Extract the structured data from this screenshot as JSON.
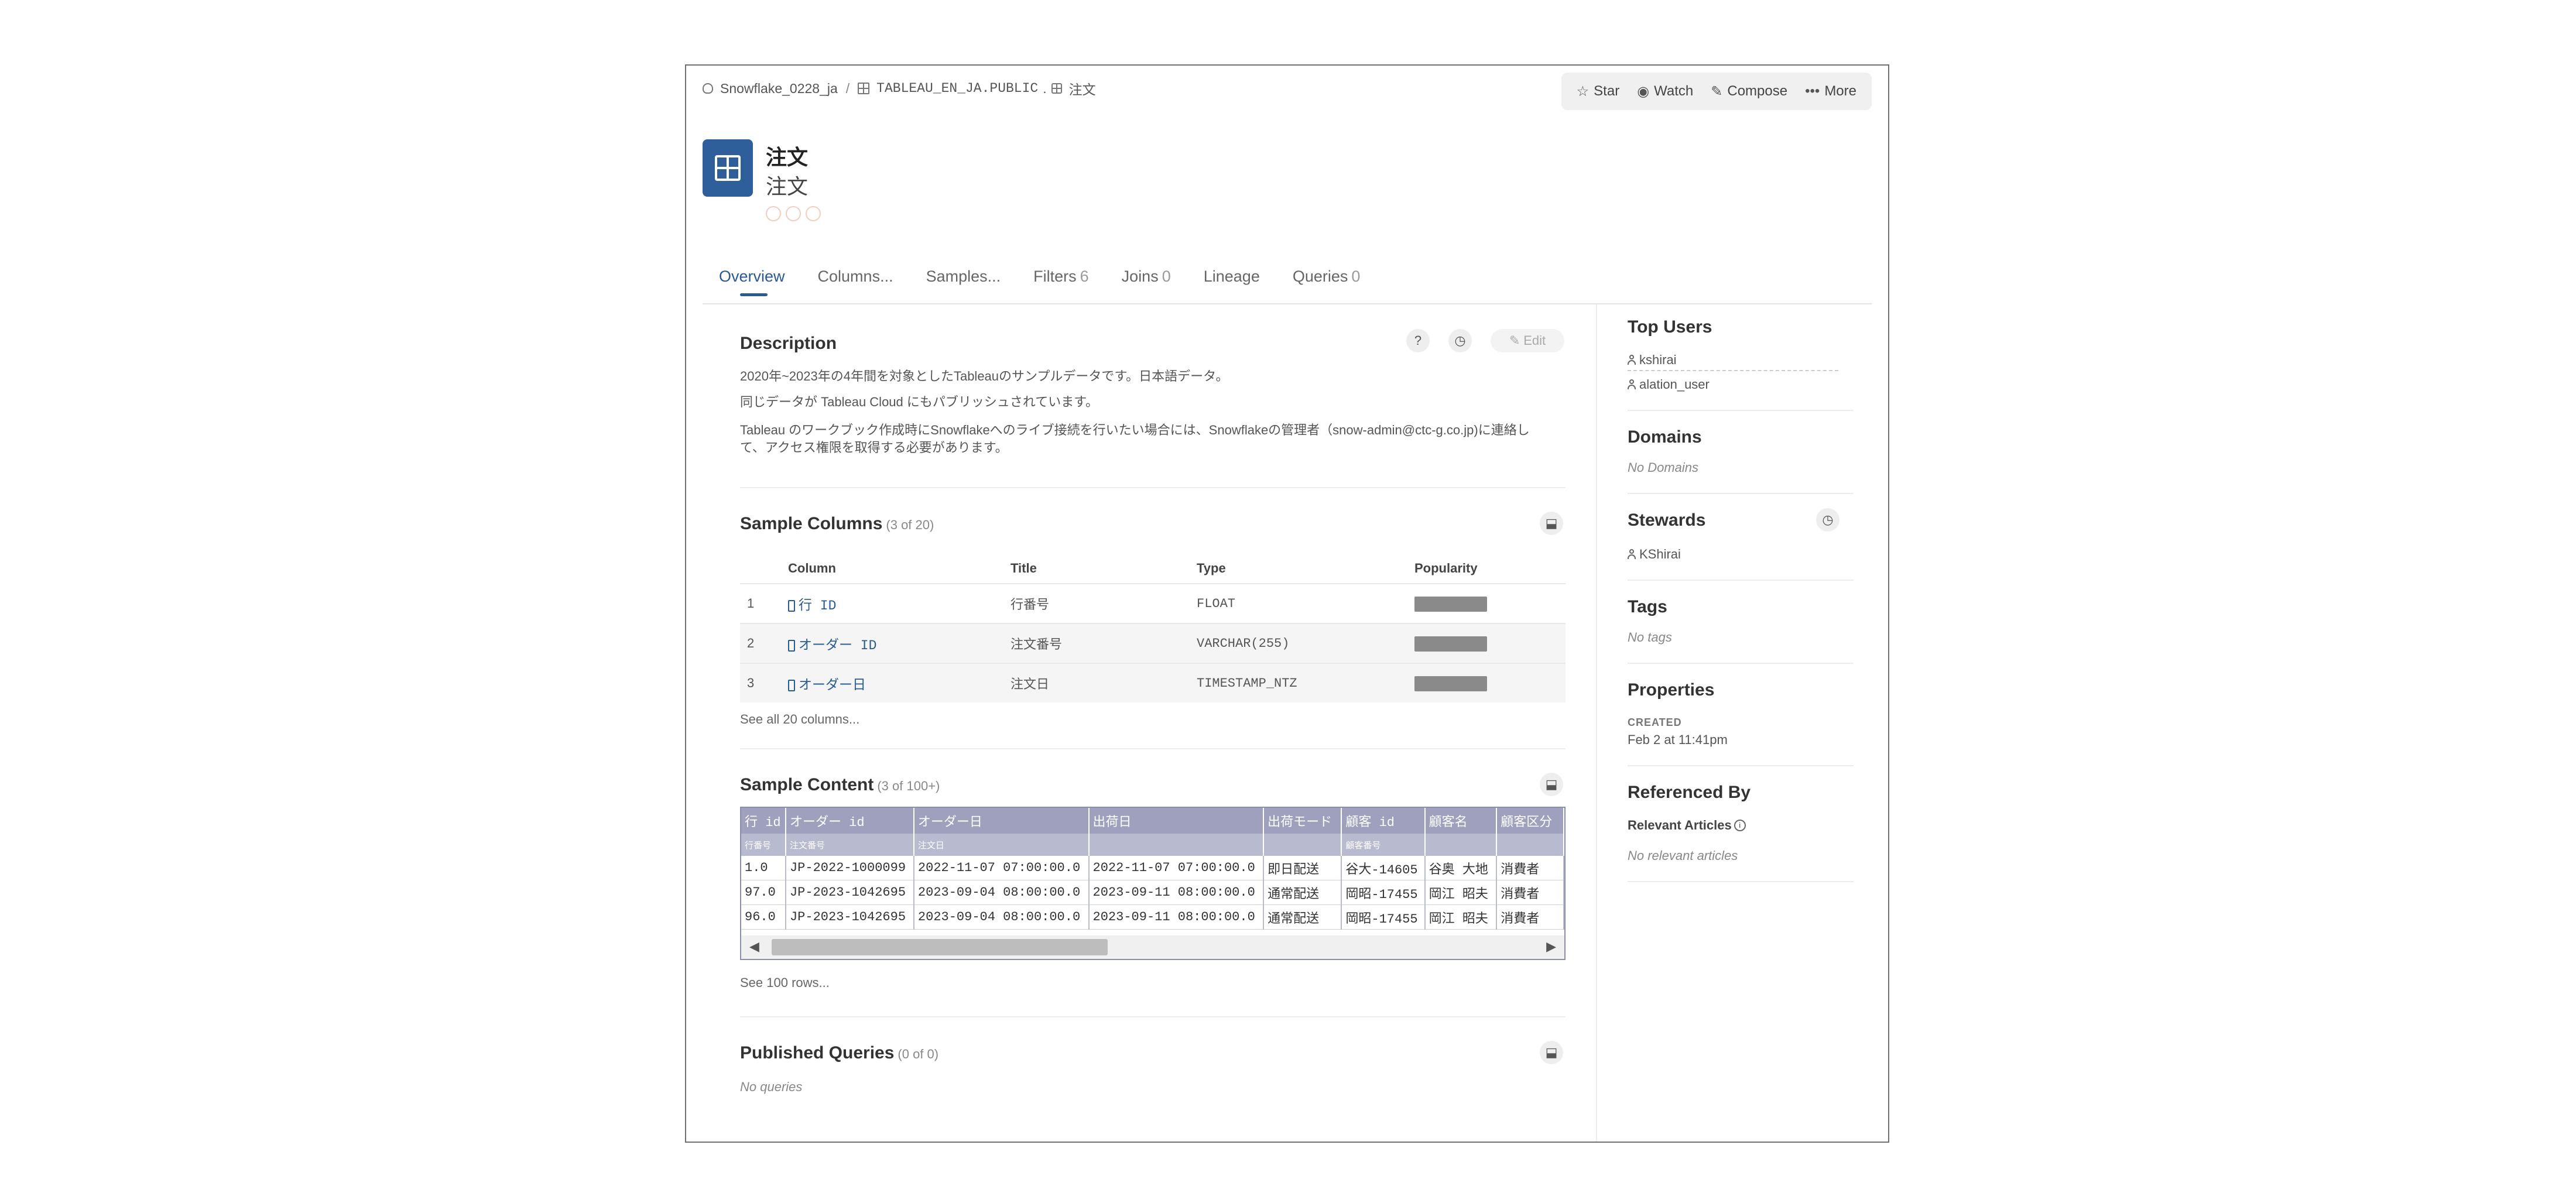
{
  "breadcrumb": {
    "database": "Snowflake_0228_ja",
    "sep1": "/",
    "schema": "TABLEAU_EN_JA.PUBLIC",
    "sep2": ".",
    "table": "注文"
  },
  "actions": {
    "star": "Star",
    "watch": "Watch",
    "compose": "Compose",
    "more": "More"
  },
  "header": {
    "title": "注文",
    "subtitle": "注文"
  },
  "tabs": [
    {
      "label": "Overview",
      "count": ""
    },
    {
      "label": "Columns...",
      "count": ""
    },
    {
      "label": "Samples...",
      "count": ""
    },
    {
      "label": "Filters",
      "count": "6"
    },
    {
      "label": "Joins",
      "count": "0"
    },
    {
      "label": "Lineage",
      "count": ""
    },
    {
      "label": "Queries",
      "count": "0"
    }
  ],
  "description": {
    "heading": "Description",
    "edit_label": "Edit",
    "lines": [
      "2020年~2023年の4年間を対象としたTableauのサンプルデータです。日本語データ。",
      "同じデータが Tableau Cloud にもパブリッシュされています。",
      "Tableau のワークブック作成時にSnowflakeへのライブ接続を行いたい場合には、Snowflakeの管理者（snow-admin@ctc-g.co.jp)に連絡し",
      "て、アクセス権限を取得する必要があります。"
    ]
  },
  "sample_columns": {
    "heading": "Sample Columns",
    "count": "(3 of 20)",
    "headers": [
      "",
      "Column",
      "Title",
      "Type",
      "Popularity"
    ],
    "rows": [
      {
        "n": "1",
        "column": "行 ID",
        "title": "行番号",
        "type": "FLOAT"
      },
      {
        "n": "2",
        "column": "オーダー ID",
        "title": "注文番号",
        "type": "VARCHAR(255)"
      },
      {
        "n": "3",
        "column": "オーダー日",
        "title": "注文日",
        "type": "TIMESTAMP_NTZ"
      }
    ],
    "see_all": "See all 20 columns..."
  },
  "sample_content": {
    "heading": "Sample Content",
    "count": "(3 of 100+)",
    "headers": [
      "行 id",
      "オーダー id",
      "オーダー日",
      "出荷日",
      "出荷モード",
      "顧客 id",
      "顧客名",
      "顧客区分"
    ],
    "subheaders": [
      "行番号",
      "注文番号",
      "注文日",
      "",
      "",
      "顧客番号",
      "",
      ""
    ],
    "rows": [
      [
        "1.0",
        "JP-2022-1000099",
        "2022-11-07 07:00:00.0",
        "2022-11-07 07:00:00.0",
        "即日配送",
        "谷大-14605",
        "谷奥 大地",
        "消費者"
      ],
      [
        "97.0",
        "JP-2023-1042695",
        "2023-09-04 08:00:00.0",
        "2023-09-11 08:00:00.0",
        "通常配送",
        "岡昭-17455",
        "岡江 昭夫",
        "消費者"
      ],
      [
        "96.0",
        "JP-2023-1042695",
        "2023-09-04 08:00:00.0",
        "2023-09-11 08:00:00.0",
        "通常配送",
        "岡昭-17455",
        "岡江 昭夫",
        "消費者"
      ]
    ],
    "see_all": "See 100 rows..."
  },
  "published_queries": {
    "heading": "Published Queries",
    "count": "(0 of 0)",
    "empty": "No queries"
  },
  "sidebar": {
    "top_users": {
      "heading": "Top Users",
      "users": [
        "kshirai",
        "alation_user"
      ]
    },
    "domains": {
      "heading": "Domains",
      "empty": "No Domains"
    },
    "stewards": {
      "heading": "Stewards",
      "users": [
        "KShirai"
      ]
    },
    "tags": {
      "heading": "Tags",
      "empty": "No tags"
    },
    "properties": {
      "heading": "Properties",
      "label": "CREATED",
      "value": "Feb 2 at 11:41pm"
    },
    "referenced_by": {
      "heading": "Referenced By",
      "sub": "Relevant Articles",
      "empty": "No relevant articles"
    }
  },
  "colors": {
    "accent": "#2a5a94",
    "icon_bg": "#2f5f9a",
    "grid_header": "#9ea0bd",
    "popularity": "#8a8a8a"
  }
}
